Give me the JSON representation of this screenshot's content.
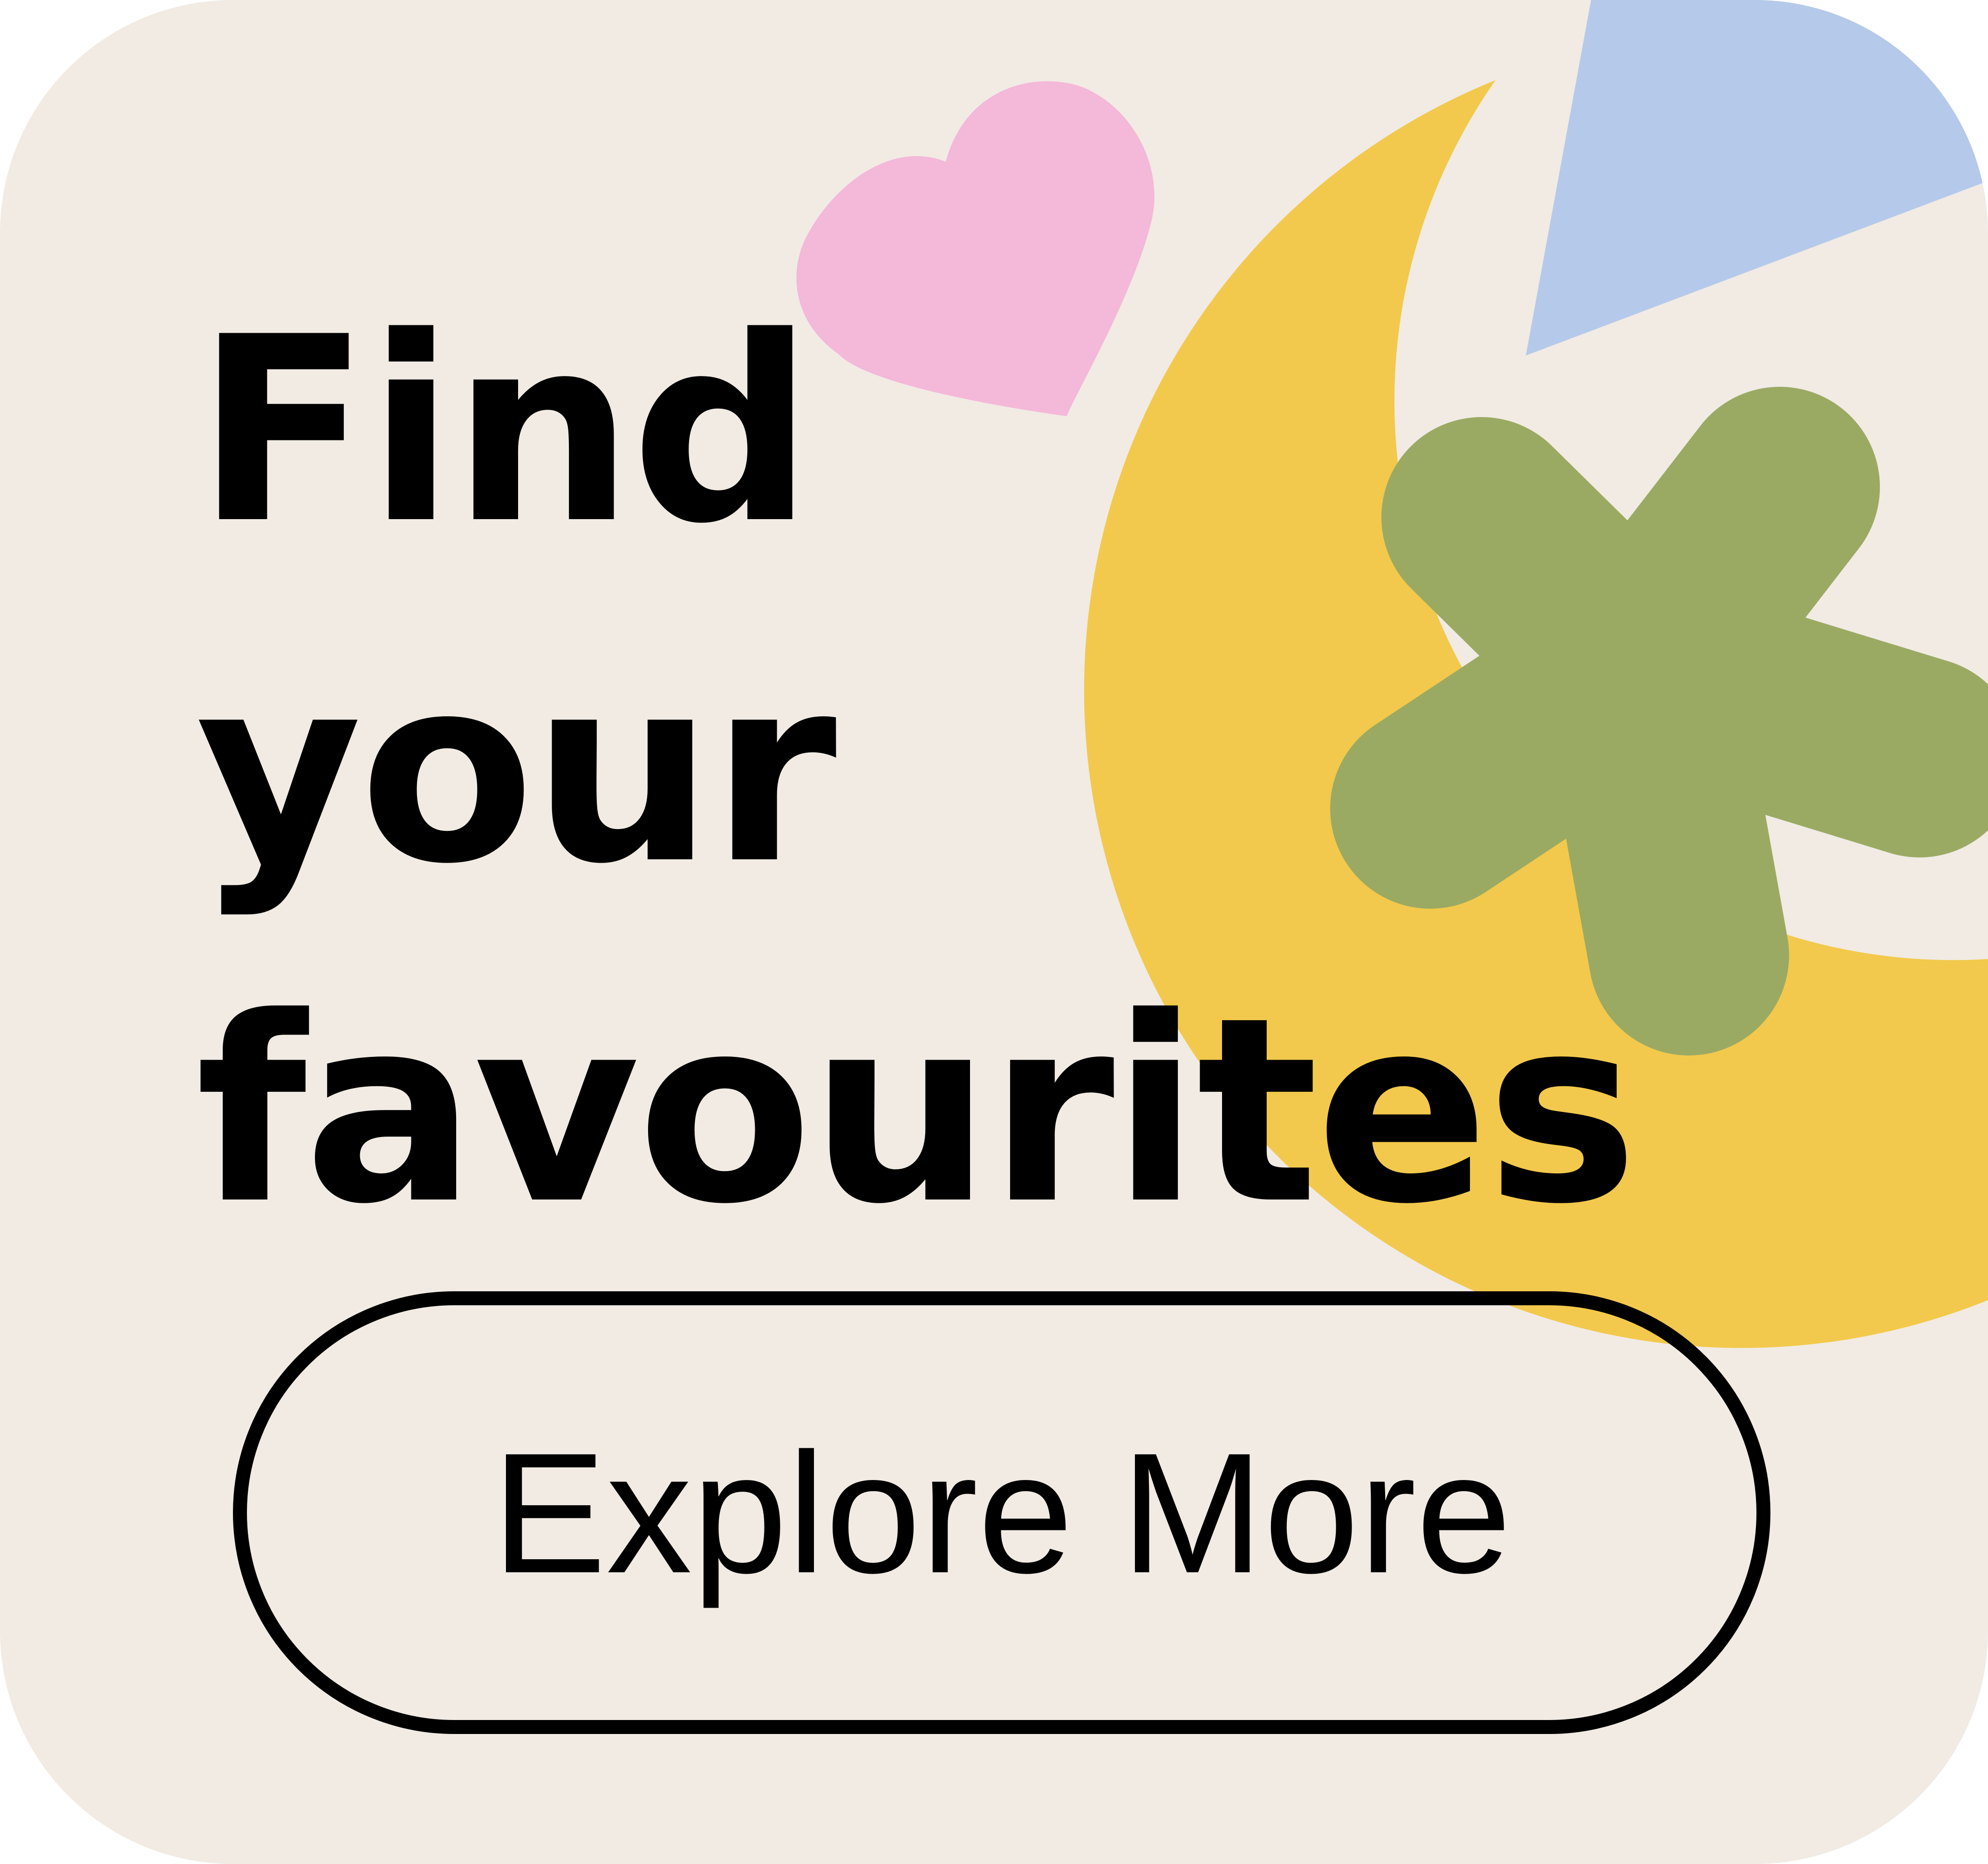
{
  "headline": {
    "line1": "Find",
    "line2": "your",
    "line3": "favourites"
  },
  "cta": {
    "label": "Explore More"
  },
  "colors": {
    "background": "#F1EBE4",
    "moon": "#F2C94C",
    "heart": "#F4B8D8",
    "triangle": "#B5CAEA",
    "asterisk": "#9BAA63",
    "text": "#000000"
  },
  "icons": [
    "heart-icon",
    "crescent-moon-icon",
    "triangle-icon",
    "asterisk-icon"
  ]
}
